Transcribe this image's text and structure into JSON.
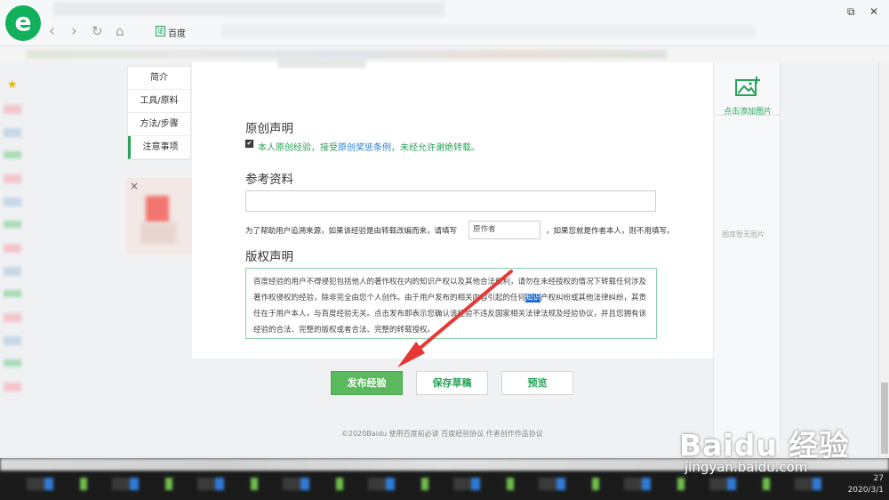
{
  "browser": {
    "logo_letter": "e",
    "address_icon": "证",
    "address_text": "百度",
    "window_buttons": [
      "⧉",
      "—"
    ]
  },
  "side_nav": {
    "items": [
      {
        "label": "简介"
      },
      {
        "label": "工具/原料"
      },
      {
        "label": "方法/步骤"
      },
      {
        "label": "注意事项"
      }
    ]
  },
  "ad": {
    "close_label": "×"
  },
  "original": {
    "title": "原创声明",
    "checkbox_mark": "✔",
    "declare_prefix": "本人原创经验，接受",
    "declare_link": "原创奖惩条例",
    "declare_suffix": "，未经允许谢绝转载。"
  },
  "reference": {
    "title": "参考资料",
    "help_prefix": "为了帮助用户追溯来源，如果该经验是由转载改编而来，请填写",
    "author_placeholder": "原作者",
    "help_suffix": "，如果您就是作者本人，则不用填写。"
  },
  "copyright": {
    "title": "版权声明",
    "text_before": "百度经验的用户不得侵犯包括他人的著作权在内的知识产权以及其他合法权利，请勿在未经授权的情况下转载任何涉及著作权侵权的经验，除非完全由您个人创作。由于用户发布的相关内容引起的任何",
    "highlight": "知识",
    "text_after": "产权纠纷或其他法律纠纷，其责任在于用户本人，与百度经验无关。点击发布即表示您确认该经验不违反国家相关法律法规及经验协议，并且您拥有该经验的合法、完整的版权或者合法、完整的转载授权。"
  },
  "buttons": {
    "publish": "发布经验",
    "save_draft": "保存草稿",
    "preview": "预览"
  },
  "footer": "©2020Baidu 使用百度前必读 百度经验协议 作者创作作品协议",
  "right_panel": {
    "add_image": "点击添加图片",
    "no_image": "图库暂无图片"
  },
  "taskbar": {
    "time": "27",
    "date": "2020/3/1"
  },
  "watermark": {
    "brand": "Baidu 经验",
    "url": "jingyan.baidu.com"
  },
  "colors": {
    "accent_green": "#2aa35a",
    "publish_button": "#59b95c",
    "arrow_red": "#e53935"
  }
}
